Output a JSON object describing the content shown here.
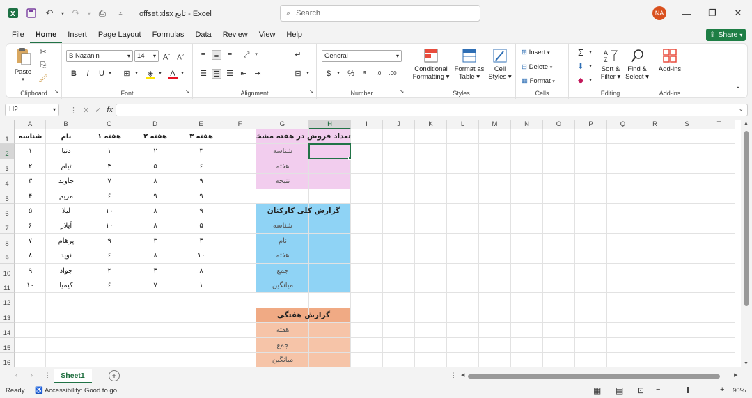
{
  "title": "offset.xlsx تابع  -  Excel",
  "search_placeholder": "Search",
  "user_initials": "NA",
  "menu": [
    "File",
    "Home",
    "Insert",
    "Page Layout",
    "Formulas",
    "Data",
    "Review",
    "View",
    "Help"
  ],
  "share_label": "Share",
  "ribbon": {
    "paste": "Paste",
    "clipboard": "Clipboard",
    "font_name": "B Nazanin",
    "font_size": "14",
    "font": "Font",
    "alignment": "Alignment",
    "number_format": "General",
    "number": "Number",
    "conditional": "Conditional",
    "formatting": "Formatting",
    "format_as": "Format as",
    "table": "Table",
    "cell": "Cell",
    "styles_btn": "Styles",
    "styles": "Styles",
    "insert": "Insert",
    "delete": "Delete",
    "format": "Format",
    "cells": "Cells",
    "sort": "Sort &",
    "filter": "Filter",
    "find": "Find &",
    "select": "Select",
    "editing": "Editing",
    "addins_btn": "Add-ins",
    "addins": "Add-ins"
  },
  "name_box": "H2",
  "columns": [
    "A",
    "B",
    "C",
    "D",
    "E",
    "F",
    "G",
    "H",
    "I",
    "J",
    "K",
    "L",
    "M",
    "N",
    "O",
    "P",
    "Q",
    "R",
    "S",
    "T"
  ],
  "rows": [
    "1",
    "2",
    "3",
    "4",
    "5",
    "6",
    "7",
    "8",
    "9",
    "10",
    "11",
    "12",
    "13",
    "14",
    "15",
    "16"
  ],
  "colors": {
    "pink": "#f2cdee",
    "blue": "#8fd3f5",
    "orange": "#f6c4a8",
    "orange_header": "#f0aa84",
    "accent": "#217346"
  },
  "table_headers": {
    "A": "شناسه",
    "B": "نام",
    "C": "هفته ۱",
    "D": "هفته ۲",
    "E": "هفته ۳"
  },
  "table_rows": [
    [
      "۱",
      "دنیا",
      "۱",
      "۲",
      "۳"
    ],
    [
      "۲",
      "تیام",
      "۴",
      "۵",
      "۶"
    ],
    [
      "۳",
      "جاوید",
      "۷",
      "۸",
      "۹"
    ],
    [
      "۴",
      "مریم",
      "۶",
      "۹",
      "۹"
    ],
    [
      "۵",
      "لیلا",
      "۱۰",
      "۸",
      "۹"
    ],
    [
      "۶",
      "آیلار",
      "۱۰",
      "۸",
      "۵"
    ],
    [
      "۷",
      "پرهام",
      "۹",
      "۳",
      "۴"
    ],
    [
      "۸",
      "نوید",
      "۶",
      "۸",
      "۱۰"
    ],
    [
      "۹",
      "جواد",
      "۲",
      "۴",
      "۸"
    ],
    [
      "۱۰",
      "کیمیا",
      "۶",
      "۷",
      "۱"
    ]
  ],
  "box1": {
    "header": "تعداد فروش در هفته مشخص",
    "labels": [
      "شناسه",
      "هفته",
      "نتیجه"
    ]
  },
  "box2": {
    "header": "گزارش کلی کارکنان",
    "labels": [
      "شناسه",
      "نام",
      "هفته",
      "جمع",
      "میانگین"
    ]
  },
  "box3": {
    "header": "گزارش هفتگی",
    "labels": [
      "هفته",
      "جمع",
      "میانگین"
    ]
  },
  "sheet_tab": "Sheet1",
  "status_ready": "Ready",
  "status_accessibility": "Accessibility: Good to go",
  "zoom": "90%"
}
